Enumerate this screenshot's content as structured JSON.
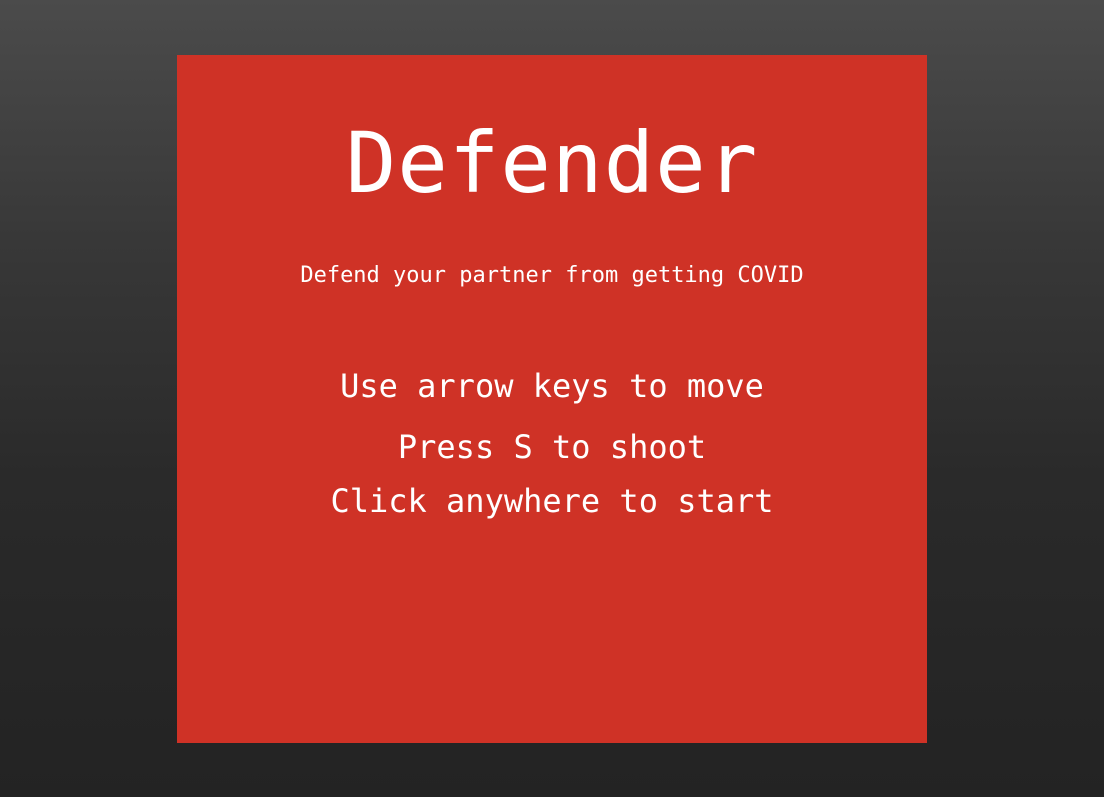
{
  "game": {
    "title": "Defender",
    "subtitle": "Defend your partner from getting COVID",
    "instructions": {
      "move": "Use arrow keys to move",
      "shoot": "Press S to shoot",
      "start": "Click anywhere to start"
    }
  },
  "colors": {
    "canvas_background": "#cf3226",
    "text": "#ffffff",
    "page_background_top": "#4b4b4b",
    "page_background_bottom": "#232323"
  }
}
